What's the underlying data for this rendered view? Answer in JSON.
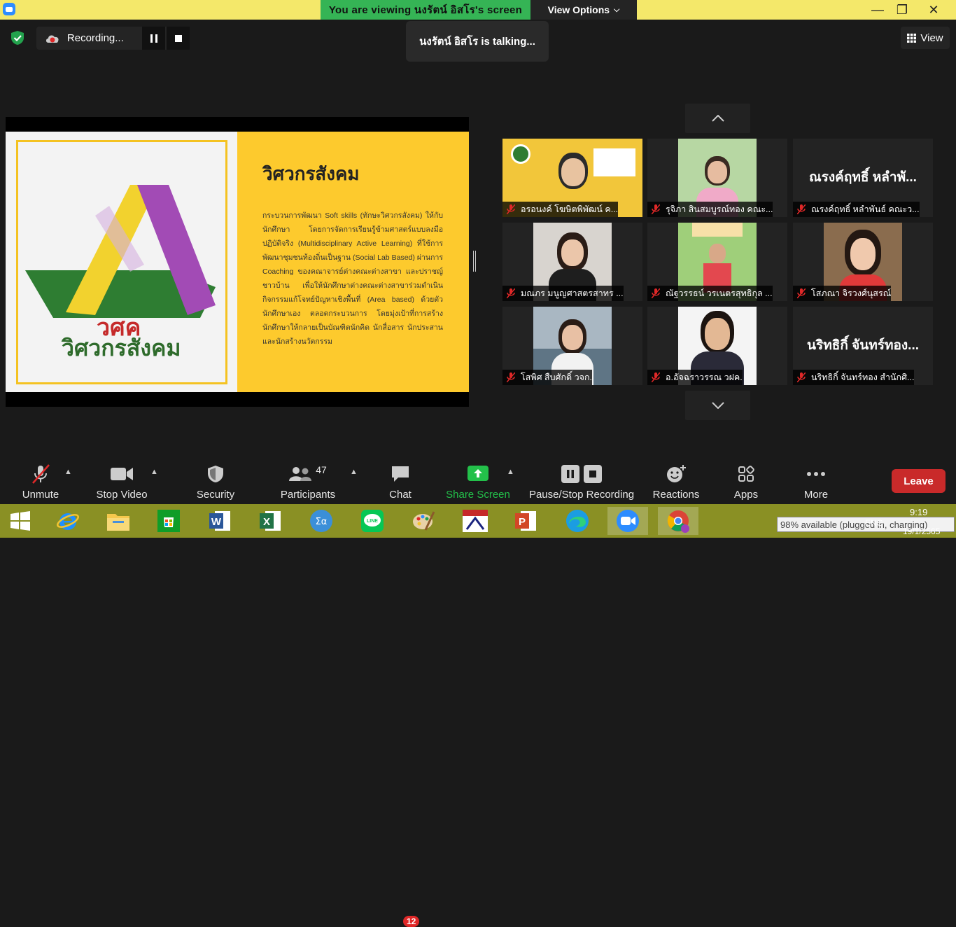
{
  "titlebar": {
    "viewing_text": "You are viewing นงรัตน์ อิสโร's screen",
    "view_options": "View Options",
    "colors": {
      "bar": "#f4e86a",
      "viewing_bg": "#35b455"
    }
  },
  "recording": {
    "label": "Recording..."
  },
  "talking": {
    "text": "นงรัตน์ อิสโร is talking..."
  },
  "view_button": {
    "label": "View"
  },
  "slide": {
    "title": "วิศวกรสังคม",
    "body": "กระบวนการพัฒนา Soft skills (ทักษะวิศวกรสังคม) ให้กับนักศึกษา โดยการจัดการเรียนรู้ข้ามศาสตร์แบบลงมือปฏิบัติจริง (Multidisciplinary Active Learning) ที่ใช้การพัฒนาชุมชนท้องถิ่นเป็นฐาน (Social Lab Based) ผ่านการ Coaching ของคณาจารย์ต่างคณะต่างสาขา และปราชญ์ชาวบ้าน เพื่อให้นักศึกษาต่างคณะต่างสาขาร่วมดำเนินกิจกรรมแก้โจทย์ปัญหาเชิงพื้นที่ (Area based) ด้วยตัวนักศึกษาเอง ตลอดกระบวนการ โดยมุ่งเป้าที่การสร้างนักศึกษาให้กลายเป็นบัณฑิตนักคิด นักสื่อสาร นักประสาน และนักสร้างนวัตกรรม",
    "logo_line1": "วศค",
    "logo_line2": "วิศวกรสังคม"
  },
  "gallery": [
    {
      "name": "อรอนงค์ โฆษิตพิพัฒน์ ค...",
      "big": "",
      "photo": true
    },
    {
      "name": "รุจิภา สินสมบูรณ์ทอง คณะ...",
      "big": "",
      "photo": true
    },
    {
      "name": "ณรงค์ฤทธิ์ หลำพันธ์ คณะว...",
      "big": "ณรงค์ฤทธิ์ หลำพั...",
      "photo": false
    },
    {
      "name": "มณภร มนูญศาสตรสาทร ...",
      "big": "",
      "photo": true
    },
    {
      "name": "ณัฐวรรธน์ วรเนตรสุทธิกุล ...",
      "big": "",
      "photo": true
    },
    {
      "name": "โสภณา จิรวงศ์นุสรณ์",
      "big": "",
      "photo": true
    },
    {
      "name": "โสพิศ สืบศักดิ์ วจก.",
      "big": "",
      "photo": true
    },
    {
      "name": "อ.อัจฉราวรรณ วฝค.",
      "big": "",
      "photo": true
    },
    {
      "name": "นริทธิกิ์ จันทร์ทอง สำนักศิ...",
      "big": "นริทธิกิ์ จันทร์ทอง...",
      "photo": false
    }
  ],
  "toolbar": {
    "unmute": "Unmute",
    "stop_video": "Stop Video",
    "security": "Security",
    "participants": "Participants",
    "participants_count": "47",
    "chat": "Chat",
    "chat_badge": "12",
    "share_screen": "Share Screen",
    "pause_stop": "Pause/Stop Recording",
    "reactions": "Reactions",
    "apps": "Apps",
    "more": "More",
    "leave": "Leave"
  },
  "taskbar": {
    "battery": "98% available (plugged in, charging)",
    "lang": "ENG",
    "time": "9:19",
    "date": "19/1/2565"
  }
}
